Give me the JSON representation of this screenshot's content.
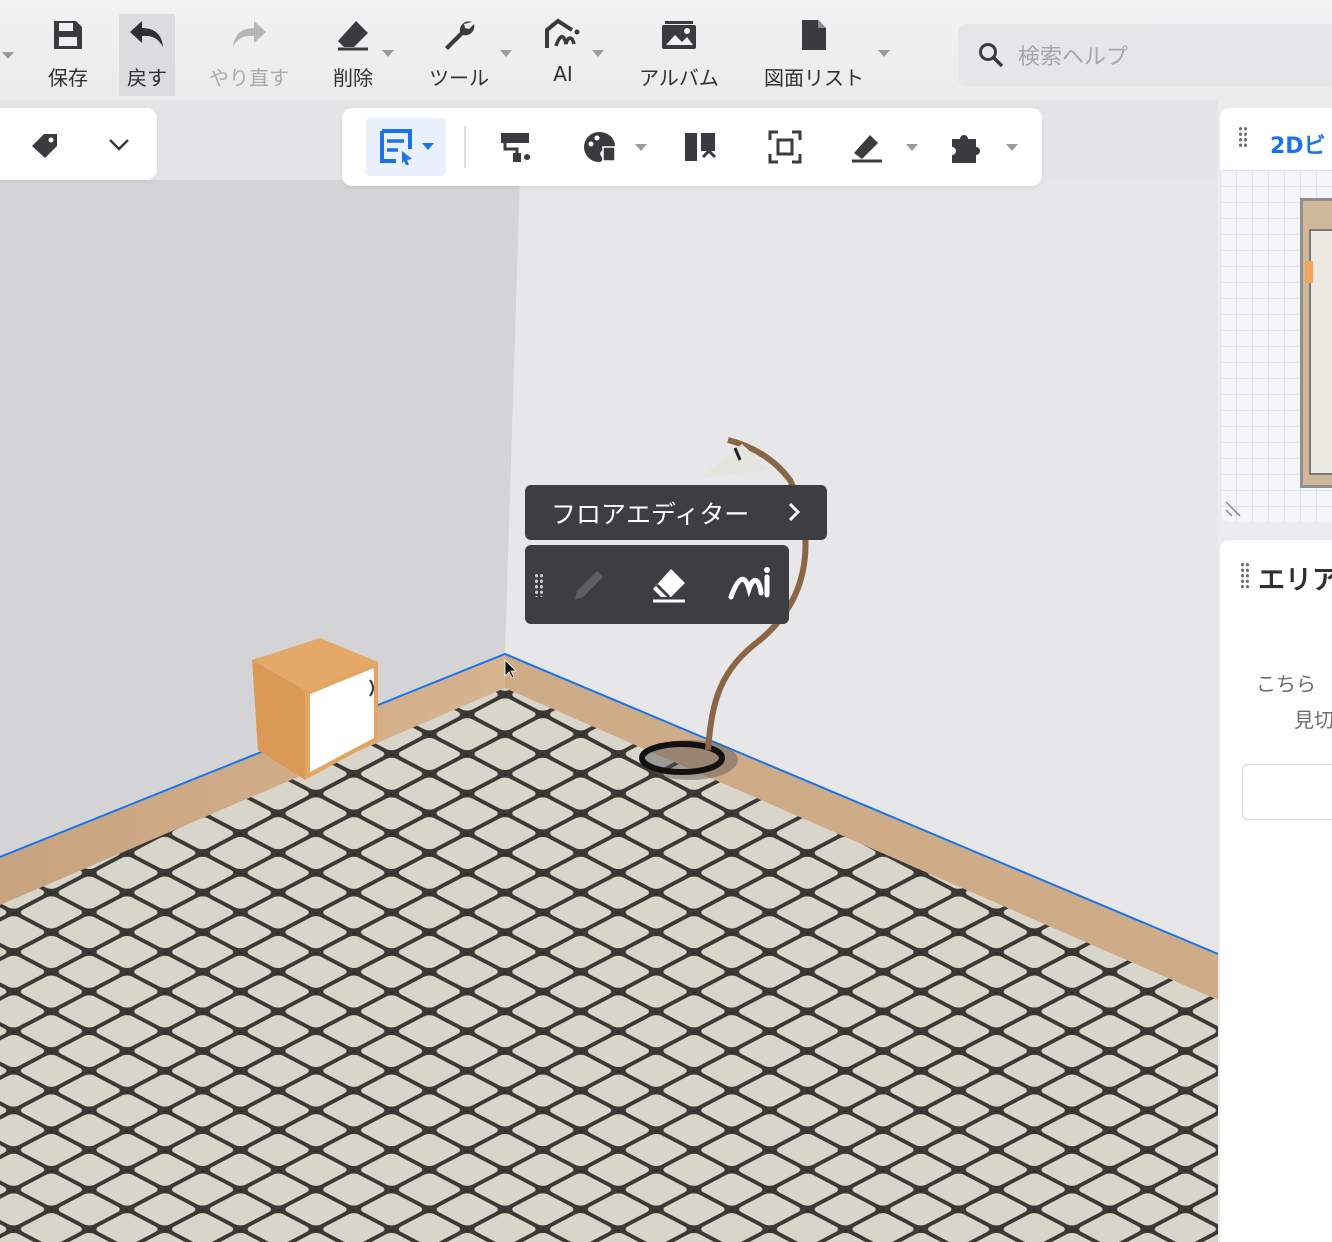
{
  "toolbar": {
    "items": [
      {
        "label": "保存",
        "icon": "save-icon"
      },
      {
        "label": "戻す",
        "icon": "undo-icon"
      },
      {
        "label": "やり直す",
        "icon": "redo-icon"
      },
      {
        "label": "削除",
        "icon": "eraser-icon"
      },
      {
        "label": "ツール",
        "icon": "wrench-icon"
      },
      {
        "label": "AI",
        "icon": "ai-icon"
      },
      {
        "label": "アルバム",
        "icon": "album-icon"
      },
      {
        "label": "図面リスト",
        "icon": "document-icon"
      }
    ]
  },
  "search": {
    "placeholder": "検索ヘルプ"
  },
  "minimap": {
    "title": "2Dビ"
  },
  "area_panel": {
    "title": "エリア",
    "text_line1": "こちら",
    "text_line2": "見切"
  },
  "floor_editor": {
    "title": "フロアエディター",
    "tools": [
      "pencil-icon",
      "eraser-icon",
      "ai-draw-icon"
    ]
  },
  "colors": {
    "accent": "#1a73e8",
    "popup_bg": "#3d3e42",
    "toolbar_bg": "#efeff0",
    "floor_tile": "#d7d4c9",
    "wood": "#cfa77f"
  }
}
